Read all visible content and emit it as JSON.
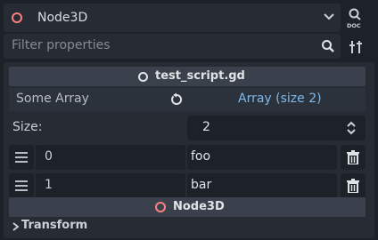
{
  "header": {
    "node_name": "Node3D",
    "node_icon": "node3d-ring-icon",
    "doc_icon": "doc-icon"
  },
  "filter": {
    "placeholder": "Filter properties",
    "search_icon": "search-icon",
    "tools_icon": "tools-icon"
  },
  "inspector": {
    "script_section": {
      "title": "test_script.gd",
      "icon": "script-icon"
    },
    "property": {
      "name": "Some Array",
      "revert_icon": "revert-icon",
      "value": "Array (size 2)"
    },
    "size": {
      "label": "Size:",
      "value": "2"
    },
    "items": [
      {
        "index": "0",
        "value": "foo"
      },
      {
        "index": "1",
        "value": "bar"
      }
    ],
    "node_section": {
      "title": "Node3D",
      "icon": "node3d-ring-icon"
    },
    "transform_group": {
      "label": "Transform"
    }
  },
  "colors": {
    "accent_blue": "#7fb8ea",
    "node3d_red": "#fc7f7f",
    "panel_bg": "#272c34",
    "base_bg": "#1d2229"
  }
}
